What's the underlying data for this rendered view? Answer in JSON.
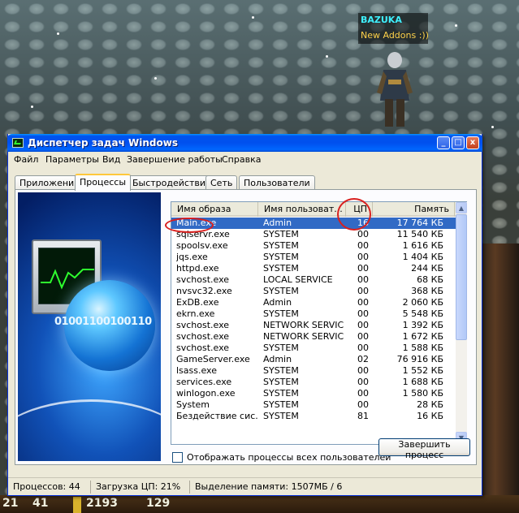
{
  "game": {
    "character_name": "BAZUKA",
    "character_guild": "New Addons :))",
    "hud_numbers": [
      "21",
      "41",
      "2193",
      "129"
    ]
  },
  "window": {
    "title": "Диспетчер задач Windows",
    "buttons": {
      "minimize": "_",
      "maximize": "□",
      "close": "x"
    },
    "menu": [
      "Файл",
      "Параметры",
      "Вид",
      "Завершение работы",
      "Справка"
    ],
    "tabs": [
      "Приложения",
      "Процессы",
      "Быстродействие",
      "Сеть",
      "Пользователи"
    ],
    "active_tab": "Процессы",
    "side_image_text": "01001100100110",
    "columns": [
      "Имя образа",
      "Имя пользоват...",
      "ЦП",
      "Память"
    ],
    "processes": [
      {
        "name": "Main.exe",
        "user": "Admin",
        "cpu": "16",
        "mem": "17 764 КБ",
        "selected": true
      },
      {
        "name": "sqlservr.exe",
        "user": "SYSTEM",
        "cpu": "00",
        "mem": "11 540 КБ"
      },
      {
        "name": "spoolsv.exe",
        "user": "SYSTEM",
        "cpu": "00",
        "mem": "1 616 КБ"
      },
      {
        "name": "jqs.exe",
        "user": "SYSTEM",
        "cpu": "00",
        "mem": "1 404 КБ"
      },
      {
        "name": "httpd.exe",
        "user": "SYSTEM",
        "cpu": "00",
        "mem": "244 КБ"
      },
      {
        "name": "svchost.exe",
        "user": "LOCAL SERVICE",
        "cpu": "00",
        "mem": "68 КБ"
      },
      {
        "name": "nvsvc32.exe",
        "user": "SYSTEM",
        "cpu": "00",
        "mem": "368 КБ"
      },
      {
        "name": "ExDB.exe",
        "user": "Admin",
        "cpu": "00",
        "mem": "2 060 КБ"
      },
      {
        "name": "ekrn.exe",
        "user": "SYSTEM",
        "cpu": "00",
        "mem": "5 548 КБ"
      },
      {
        "name": "svchost.exe",
        "user": "NETWORK SERVICE",
        "cpu": "00",
        "mem": "1 392 КБ"
      },
      {
        "name": "svchost.exe",
        "user": "NETWORK SERVICE",
        "cpu": "00",
        "mem": "1 672 КБ"
      },
      {
        "name": "svchost.exe",
        "user": "SYSTEM",
        "cpu": "00",
        "mem": "1 588 КБ"
      },
      {
        "name": "GameServer.exe",
        "user": "Admin",
        "cpu": "02",
        "mem": "76 916 КБ"
      },
      {
        "name": "lsass.exe",
        "user": "SYSTEM",
        "cpu": "00",
        "mem": "1 552 КБ"
      },
      {
        "name": "services.exe",
        "user": "SYSTEM",
        "cpu": "00",
        "mem": "1 688 КБ"
      },
      {
        "name": "winlogon.exe",
        "user": "SYSTEM",
        "cpu": "00",
        "mem": "1 580 КБ"
      },
      {
        "name": "System",
        "user": "SYSTEM",
        "cpu": "00",
        "mem": "28 КБ"
      },
      {
        "name": "Бездействие сис...",
        "user": "SYSTEM",
        "cpu": "81",
        "mem": "16 КБ"
      }
    ],
    "show_all_users_label": "Отображать процессы всех пользователей",
    "show_all_users_checked": false,
    "end_process_label": "Завершить процесс",
    "status": {
      "processes": "Процессов: 44",
      "cpu": "Загрузка ЦП: 21%",
      "memory": "Выделение памяти: 1507МБ / 6"
    },
    "colors": {
      "title_bar": "#0054e3",
      "selection": "#316ac5",
      "annotation": "#d9201e"
    },
    "icons": [
      "taskmgr-icon",
      "minimize-icon",
      "maximize-icon",
      "close-icon",
      "scroll-up-icon",
      "scroll-down-icon"
    ]
  }
}
